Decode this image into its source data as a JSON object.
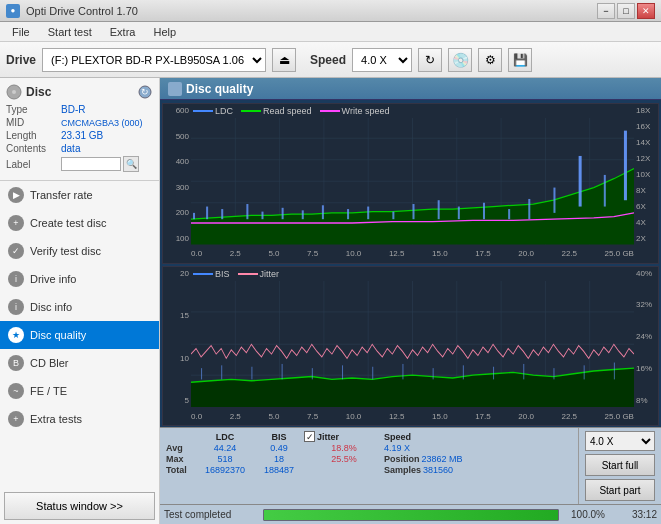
{
  "app": {
    "title": "Opti Drive Control 1.70",
    "icon": "●"
  },
  "titlebar": {
    "minimize": "−",
    "maximize": "□",
    "close": "✕"
  },
  "menu": {
    "items": [
      "File",
      "Start test",
      "Extra",
      "Help"
    ]
  },
  "toolbar": {
    "drive_label": "Drive",
    "drive_value": "(F:)  PLEXTOR BD-R  PX-LB950SA 1.06",
    "speed_label": "Speed",
    "speed_value": "4.0 X"
  },
  "disc": {
    "title": "Disc",
    "type_label": "Type",
    "type_value": "BD-R",
    "mid_label": "MID",
    "mid_value": "CMCMAGBA3 (000)",
    "length_label": "Length",
    "length_value": "23.31 GB",
    "contents_label": "Contents",
    "contents_value": "data",
    "label_label": "Label",
    "label_value": ""
  },
  "nav": {
    "items": [
      {
        "id": "transfer-rate",
        "label": "Transfer rate",
        "active": false
      },
      {
        "id": "create-test-disc",
        "label": "Create test disc",
        "active": false
      },
      {
        "id": "verify-test-disc",
        "label": "Verify test disc",
        "active": false
      },
      {
        "id": "drive-info",
        "label": "Drive info",
        "active": false
      },
      {
        "id": "disc-info",
        "label": "Disc info",
        "active": false
      },
      {
        "id": "disc-quality",
        "label": "Disc quality",
        "active": true
      },
      {
        "id": "cd-bler",
        "label": "CD Bler",
        "active": false
      },
      {
        "id": "fe-te",
        "label": "FE / TE",
        "active": false
      },
      {
        "id": "extra-tests",
        "label": "Extra tests",
        "active": false
      }
    ],
    "status_btn": "Status window >>"
  },
  "content": {
    "title": "Disc quality"
  },
  "chart1": {
    "legend": [
      {
        "label": "LDC",
        "color": "#4488ff"
      },
      {
        "label": "Read speed",
        "color": "#00cc00"
      },
      {
        "label": "Write speed",
        "color": "#ff44ff"
      }
    ],
    "y_labels_left": [
      "600",
      "500",
      "400",
      "300",
      "200",
      "100"
    ],
    "y_labels_right": [
      "18X",
      "16X",
      "14X",
      "12X",
      "10X",
      "8X",
      "6X",
      "4X",
      "2X"
    ],
    "x_labels": [
      "0.0",
      "2.5",
      "5.0",
      "7.5",
      "10.0",
      "12.5",
      "15.0",
      "17.5",
      "20.0",
      "22.5",
      "25.0 GB"
    ]
  },
  "chart2": {
    "legend": [
      {
        "label": "BIS",
        "color": "#4488ff"
      },
      {
        "label": "Jitter",
        "color": "#ff88aa"
      }
    ],
    "y_labels_left": [
      "20",
      "15",
      "10",
      "5"
    ],
    "y_labels_right": [
      "40%",
      "32%",
      "24%",
      "16%",
      "8%"
    ],
    "x_labels": [
      "0.0",
      "2.5",
      "5.0",
      "7.5",
      "10.0",
      "12.5",
      "15.0",
      "17.5",
      "20.0",
      "22.5",
      "25.0 GB"
    ]
  },
  "stats": {
    "col_ldc": "LDC",
    "col_bis": "BIS",
    "jitter_checkbox": true,
    "col_jitter": "Jitter",
    "col_speed": "Speed",
    "col_position": "Position",
    "col_samples": "Samples",
    "rows": [
      {
        "label": "Avg",
        "ldc": "44.24",
        "bis": "0.49",
        "jitter": "18.8%",
        "speed": "4.19 X"
      },
      {
        "label": "Max",
        "ldc": "518",
        "bis": "18",
        "jitter": "25.5%",
        "position": "23862 MB"
      },
      {
        "label": "Total",
        "ldc": "16892370",
        "bis": "188487",
        "samples": "381560"
      }
    ],
    "speed_select": "4.0 X",
    "start_full_label": "Start full",
    "start_part_label": "Start part"
  },
  "progress": {
    "status_text": "Test completed",
    "percentage": "100.0%",
    "time": "33:12"
  }
}
